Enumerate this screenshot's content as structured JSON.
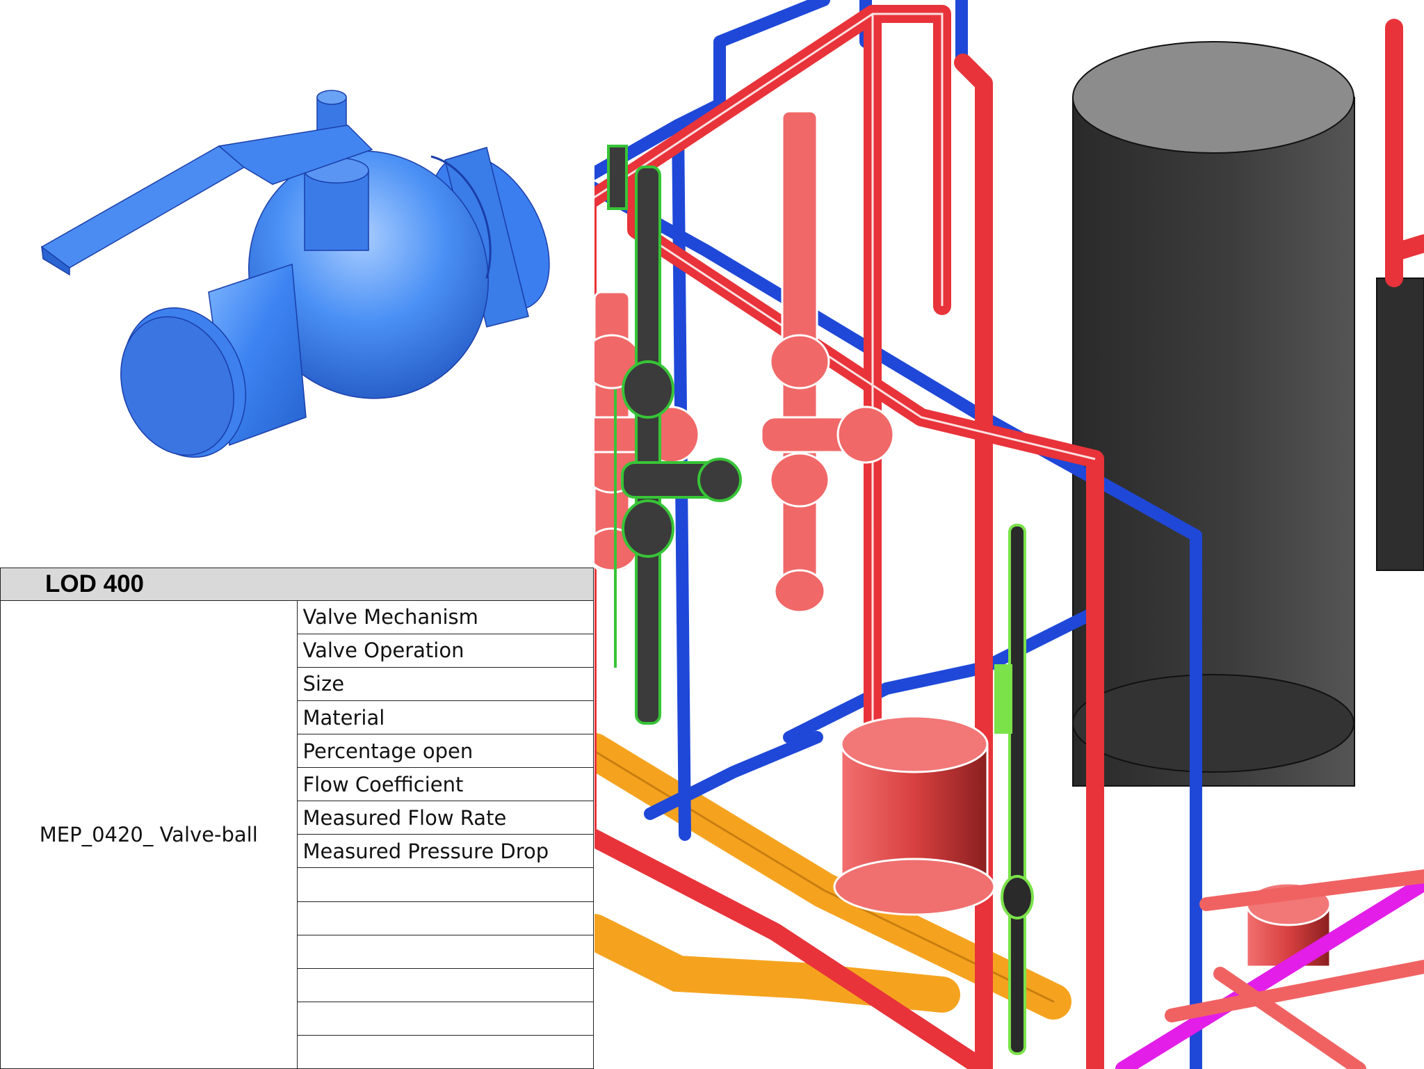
{
  "lod_table": {
    "header": "LOD 400",
    "element_name": "MEP_0420_ Valve-ball",
    "properties": [
      "Valve Mechanism",
      "Valve Operation",
      "Size",
      "Material",
      "Percentage open",
      "Flow Coefficient",
      "Measured Flow Rate",
      "Measured Pressure Drop",
      "",
      "",
      "",
      "",
      "",
      ""
    ]
  },
  "colors": {
    "valve_blue": "#3d84f2",
    "hot_pipe_red": "#e8333a",
    "cold_pipe_blue": "#1f48d8",
    "drain_orange": "#f5a31f",
    "tank_grey": "#3c3c3c",
    "green_assembly": "#2f8a2f",
    "magenta_pipe": "#e21ee8"
  }
}
